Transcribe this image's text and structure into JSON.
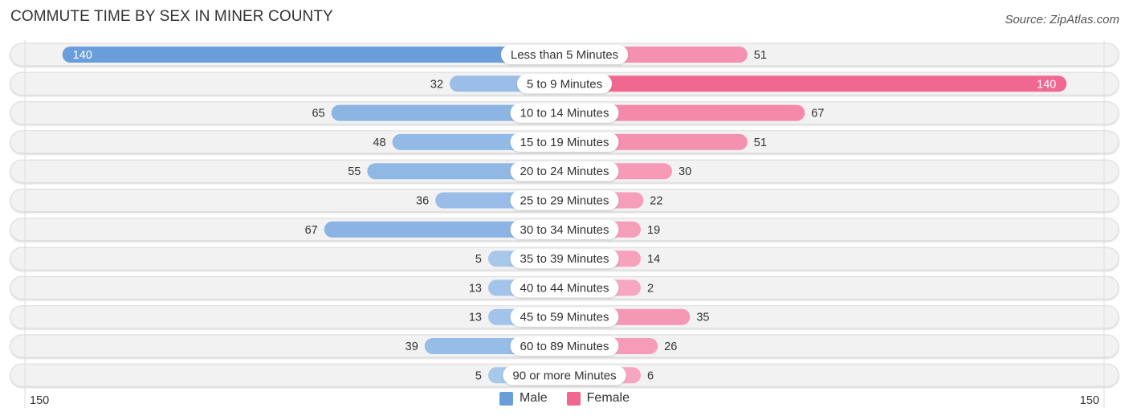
{
  "header": {
    "title": "COMMUTE TIME BY SEX IN MINER COUNTY",
    "source": "Source: ZipAtlas.com"
  },
  "legend": [
    {
      "label": "Male",
      "color": "#6a9edb"
    },
    {
      "label": "Female",
      "color": "#f06892"
    }
  ],
  "axis": {
    "left_label": "150",
    "right_label": "150"
  },
  "colors": {
    "male_strong": "#6a9edb",
    "male_light": "#a9c8ec",
    "female_strong": "#f06892",
    "female_light": "#f7a8c2",
    "track": "#f2f2f2"
  },
  "chart_data": {
    "type": "bar",
    "orientation": "horizontal-diverging",
    "title": "COMMUTE TIME BY SEX IN MINER COUNTY",
    "categories": [
      "Less than 5 Minutes",
      "5 to 9 Minutes",
      "10 to 14 Minutes",
      "15 to 19 Minutes",
      "20 to 24 Minutes",
      "25 to 29 Minutes",
      "30 to 34 Minutes",
      "35 to 39 Minutes",
      "40 to 44 Minutes",
      "45 to 59 Minutes",
      "60 to 89 Minutes",
      "90 or more Minutes"
    ],
    "series": [
      {
        "name": "Male",
        "values": [
          140,
          32,
          65,
          48,
          55,
          36,
          67,
          5,
          13,
          13,
          39,
          5
        ]
      },
      {
        "name": "Female",
        "values": [
          51,
          140,
          67,
          51,
          30,
          22,
          19,
          14,
          2,
          35,
          26,
          6
        ]
      }
    ],
    "xlim": [
      -150,
      150
    ],
    "xlabel": "",
    "ylabel": "",
    "legend": "bottom-center",
    "grid": false
  }
}
